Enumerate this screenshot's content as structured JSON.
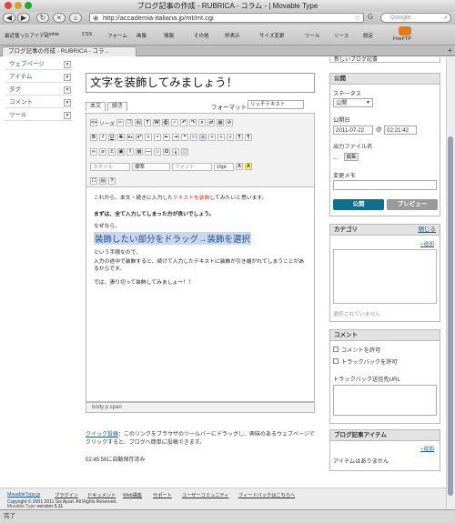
{
  "browser": {
    "window_title": "ブログ記事の作成 - RUBRICA - コラム - | Movable Type",
    "url": "http://accademia-italiana.jp/mt/mt.cgi",
    "search_placeholder": "Google",
    "bookmarks": [
      "最近使ったアイテム",
      "Cookie",
      "CSS",
      "フォーム",
      "画像",
      "情報",
      "その他",
      "枠表示",
      "サイズ変更",
      "ツール",
      "ソース",
      "設定",
      "FireFTP"
    ],
    "tab_label": "ブログ記事の作成 - RUBRICA - コラ...",
    "status": "完了"
  },
  "sidebar": {
    "items": [
      "ウェブページ",
      "アイテム",
      "タグ",
      "コメント",
      "ツール"
    ]
  },
  "entry": {
    "title": "文字を装飾してみましょう！",
    "tab_body": "本文",
    "tab_more": "続き",
    "format_label": "フォーマット:",
    "format_value": "リッチテキスト",
    "source_label": "ソース",
    "style_placeholder": "スタイル",
    "block_value": "標準",
    "font_placeholder": "フォント",
    "size_value": "15pt",
    "lines": [
      "これから、本文・続きに入力した",
      "テキストを装飾",
      "してみたいと思います。",
      "まずは、全て入力してしまった方が良いでしょう。",
      "なぜなら、",
      "装飾したい部分をドラッグ→装飾を選択",
      "という手順なので、",
      "入力の途中で装飾すると、続けて入力したテキストに装飾が引き継がれてしまうことがあるからです。",
      "では、張り切って装飾してみましょー！！"
    ],
    "path": "body  p  span",
    "quickpost_link": "クイック投稿",
    "quickpost_text": "このリンクをブラウザのツールバーにドラッグし、興味のあるウェブページでクリックすると、ブログへ簡単に投稿できます。",
    "autosave": "02:45:58に自動保存済み"
  },
  "publish": {
    "recent": "新しいブログ記事",
    "header": "公開",
    "status_label": "ステータス",
    "status_value": "公開",
    "date_label": "公開日",
    "date_value": "2011-07-22",
    "time_value": "02:21:42",
    "filename_label": "出力ファイル名",
    "filename_value": "...",
    "edit_button": "編集",
    "memo_label": "変更メモ",
    "publish_button": "公開",
    "preview_button": "プレビュー"
  },
  "category": {
    "header": "カテゴリ",
    "close": "閉じる",
    "add": "追加",
    "empty": "選択されていません"
  },
  "comment": {
    "header": "コメント",
    "allow_comments": "コメントを許可",
    "allow_trackbacks": "トラックバックを許可",
    "tb_url_label": "トラックバック送信先URL"
  },
  "assets": {
    "header": "ブログ記事アイテム",
    "add": "追加",
    "empty": "アイテムはありません"
  },
  "footer": {
    "links": [
      "MovableType.jp",
      "プラグイン",
      "ドキュメント",
      "Web講座",
      "サポート",
      "ユーザーコミュニティ",
      "フィードバックはこちらへ"
    ],
    "copyright": "Copyright © 2001-2011 Six Apart. All Rights Reserved.",
    "version_prefix": "Movable Type",
    "version": "version 5.11"
  },
  "colors": {
    "accent": "#0e6f8e",
    "link": "#1a5a9a",
    "highlight": "#c8d8f0",
    "red_text": "#e03030"
  }
}
